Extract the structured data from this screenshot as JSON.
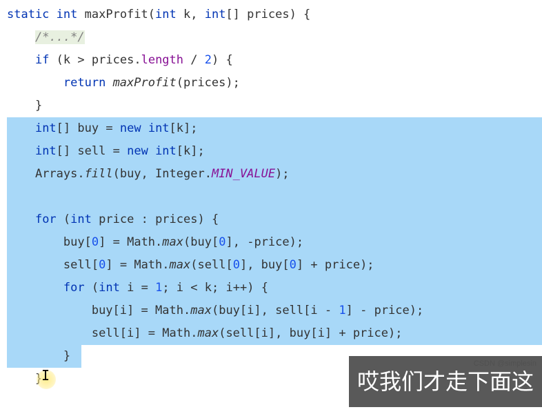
{
  "code": {
    "l1_kw1": "static",
    "l1_kw2": "int",
    "l1_method": "maxProfit",
    "l1_kw3": "int",
    "l1_var1": "k",
    "l1_kw4": "int",
    "l1_var2": "prices",
    "l2_comment": "/*...*/",
    "l3_kw1": "if",
    "l3_var1": "k",
    "l3_op1": ">",
    "l3_var2": "prices",
    "l3_field": "length",
    "l3_op2": "/",
    "l3_num": "2",
    "l4_kw1": "return",
    "l4_method": "maxProfit",
    "l4_var1": "prices",
    "l5_brace": "}",
    "l6_kw1": "int",
    "l6_var1": "buy",
    "l6_op": "=",
    "l6_kw2": "new",
    "l6_kw3": "int",
    "l6_var2": "k",
    "l7_kw1": "int",
    "l7_var1": "sell",
    "l7_op": "=",
    "l7_kw2": "new",
    "l7_kw3": "int",
    "l7_var2": "k",
    "l8_cls": "Arrays",
    "l8_method": "fill",
    "l8_var1": "buy",
    "l8_cls2": "Integer",
    "l8_const": "MIN_VALUE",
    "l10_kw1": "for",
    "l10_kw2": "int",
    "l10_var1": "price",
    "l10_op": ":",
    "l10_var2": "prices",
    "l11_var1": "buy",
    "l11_num1": "0",
    "l11_op": "=",
    "l11_cls": "Math",
    "l11_method": "max",
    "l11_var2": "buy",
    "l11_num2": "0",
    "l11_op2": "-",
    "l11_var3": "price",
    "l12_var1": "sell",
    "l12_num1": "0",
    "l12_op": "=",
    "l12_cls": "Math",
    "l12_method": "max",
    "l12_var2": "sell",
    "l12_num2": "0",
    "l12_var3": "buy",
    "l12_num3": "0",
    "l12_op2": "+",
    "l12_var4": "price",
    "l13_kw1": "for",
    "l13_kw2": "int",
    "l13_var1": "i",
    "l13_op1": "=",
    "l13_num1": "1",
    "l13_var2": "i",
    "l13_op2": "<",
    "l13_var3": "k",
    "l13_var4": "i",
    "l13_op3": "++",
    "l14_var1": "buy",
    "l14_var2": "i",
    "l14_op": "=",
    "l14_cls": "Math",
    "l14_method": "max",
    "l14_var3": "buy",
    "l14_var4": "i",
    "l14_var5": "sell",
    "l14_var6": "i",
    "l14_op2": "-",
    "l14_num": "1",
    "l14_op3": "-",
    "l14_var7": "price",
    "l15_var1": "sell",
    "l15_var2": "i",
    "l15_op": "=",
    "l15_cls": "Math",
    "l15_method": "max",
    "l15_var3": "sell",
    "l15_var4": "i",
    "l15_var5": "buy",
    "l15_var6": "i",
    "l15_op2": "+",
    "l15_var7": "price",
    "l16_brace": "}",
    "l17_brace": "}"
  },
  "subtitle": "哎我们才走下面这",
  "watermark": "CSDN @simplesin"
}
